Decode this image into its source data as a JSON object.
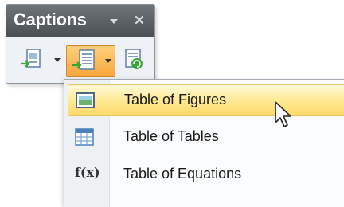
{
  "panel": {
    "title": "Captions"
  },
  "toolbar": {
    "buttons": [
      {
        "icon": "insert-caption-icon",
        "has_dropdown": true,
        "active": false
      },
      {
        "icon": "insert-table-of-captions-icon",
        "has_dropdown": true,
        "active": true
      },
      {
        "icon": "update-table-icon",
        "has_dropdown": false,
        "active": false
      }
    ]
  },
  "menu": {
    "items": [
      {
        "label": "Table of Figures",
        "icon": "image-icon",
        "hovered": true
      },
      {
        "label": "Table of Tables",
        "icon": "table-icon",
        "hovered": false
      },
      {
        "label": "Table of Equations",
        "icon": "fx-icon",
        "icon_text": "f(x)",
        "hovered": false
      }
    ]
  },
  "colors": {
    "active_button": "#f7a73c",
    "hover_highlight": "#ffe88f",
    "header": "#5a5f63"
  }
}
